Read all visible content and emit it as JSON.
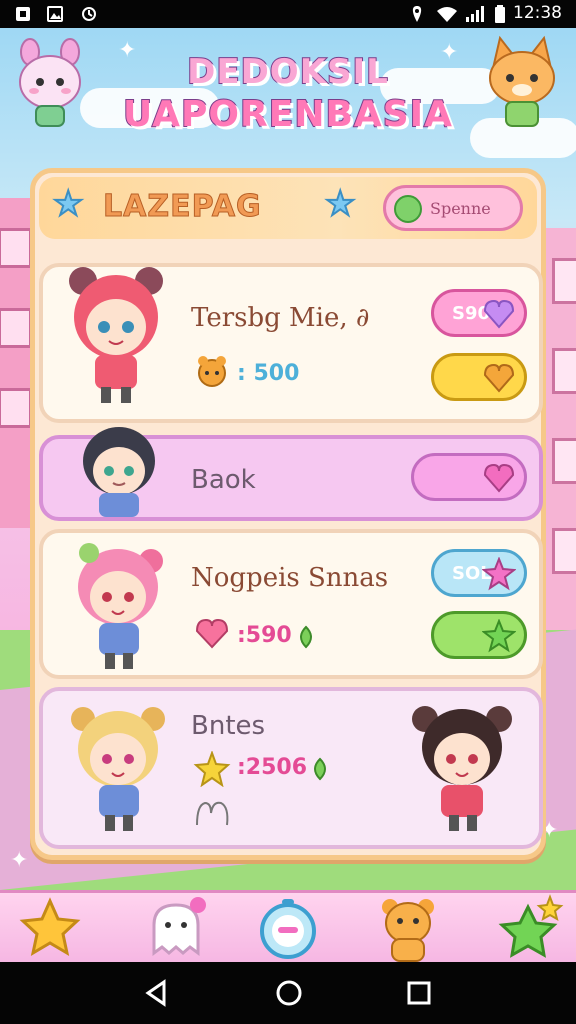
{
  "status_bar": {
    "time": "12:38"
  },
  "title": {
    "line1": "DEDOKSIL",
    "line2": "UAPORENBASIA"
  },
  "panel": {
    "heading": "LAZEPAG",
    "spend_button_label": "Spenne"
  },
  "cards": [
    {
      "name": "Tersbg Mie, ∂",
      "stat_value": ": 500",
      "button_label": "S90"
    },
    {
      "name": "Baok"
    },
    {
      "name": "Nogpeis Snnas",
      "stat_value": ":590",
      "button_label": "SOL"
    },
    {
      "name": "Bntes",
      "stat_value": ":2506"
    }
  ],
  "colors": {
    "accent_pink": "#ff79b7",
    "panel_border": "#f6c888",
    "button_yellow": "#ffd84a",
    "button_green": "#9ee36a"
  },
  "bottom_nav": [
    "star-icon",
    "ghost-icon",
    "timer-icon",
    "bear-icon",
    "green-star-icon"
  ]
}
